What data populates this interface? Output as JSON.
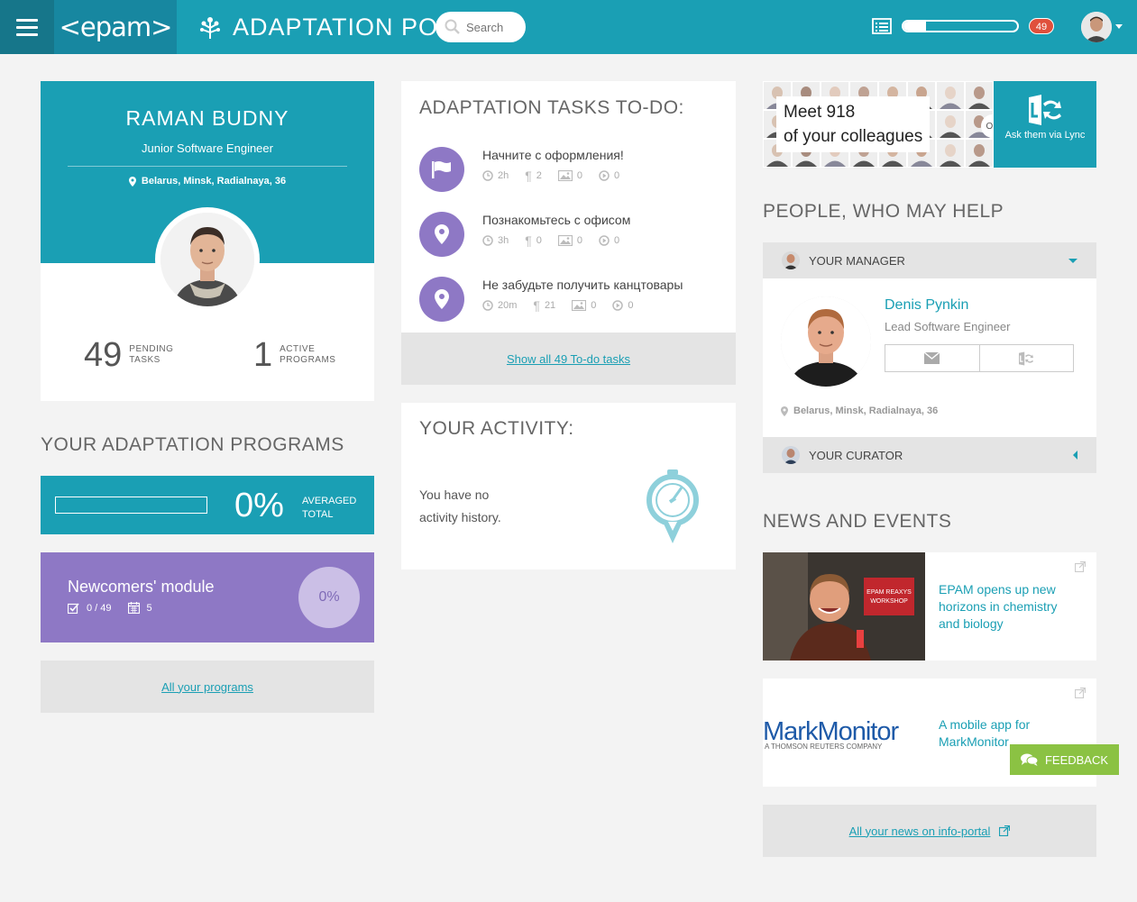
{
  "header": {
    "logo_text": "<epam>",
    "portal_title": "ADAPTATION PORTAL",
    "search_placeholder": "Search",
    "progress_fraction": 0.2,
    "notifications_count": "49"
  },
  "profile": {
    "name": "RAMAN BUDNY",
    "role": "Junior Software Engineer",
    "location": "Belarus, Minsk, Radialnaya, 36",
    "stats": [
      {
        "value": "49",
        "label_line1": "PENDING",
        "label_line2": "TASKS"
      },
      {
        "value": "1",
        "label_line1": "ACTIVE",
        "label_line2": "PROGRAMS"
      }
    ]
  },
  "programs": {
    "section_title": "YOUR ADAPTATION PROGRAMS",
    "averaged_percent": "0%",
    "averaged_fraction": 0,
    "averaged_label_line1": "AVERAGED",
    "averaged_label_line2": "TOTAL",
    "module": {
      "name": "Newcomers' module",
      "tasks_done": "0 / 49",
      "events": "5",
      "percent": "0%"
    },
    "all_link": "All your programs"
  },
  "tasks": {
    "section_title": "ADAPTATION TASKS TO-DO:",
    "items": [
      {
        "title": "Начните с оформления!",
        "time": "2h",
        "paragraphs": "2",
        "images": "0",
        "videos": "0",
        "icon": "flag-icon"
      },
      {
        "title": "Познакомьтесь с офисом",
        "time": "3h",
        "paragraphs": "0",
        "images": "0",
        "videos": "0",
        "icon": "location-pin-icon"
      },
      {
        "title": "Не забудьте получить канцтовары",
        "time": "20m",
        "paragraphs": "21",
        "images": "0",
        "videos": "0",
        "icon": "location-pin-icon"
      }
    ],
    "show_all_link": "Show all 49 To-do tasks"
  },
  "activity": {
    "section_title": "YOUR ACTIVITY:",
    "empty_text": "You have no activity history."
  },
  "meet": {
    "line1": "Meet 918",
    "line2": "of your colleagues",
    "or_text": "OR",
    "lync_label": "Ask them via Lync"
  },
  "people": {
    "section_title": "PEOPLE, WHO MAY HELP",
    "manager_header": "YOUR MANAGER",
    "manager_name": "Denis Pynkin",
    "manager_role": "Lead Software Engineer",
    "manager_location": "Belarus, Minsk, Radialnaya, 36",
    "curator_header": "YOUR CURATOR"
  },
  "news": {
    "section_title": "NEWS AND EVENTS",
    "items": [
      {
        "title": "EPAM opens up new horizons in chemistry and biology",
        "image_caption": "EPAM REAXYS WORKSHOP"
      },
      {
        "title": "A mobile app for MarkMonitor",
        "image_caption": "MarkMonitor",
        "image_subcaption": "A THOMSON REUTERS COMPANY"
      }
    ],
    "all_link": "All your news on info-portal"
  },
  "feedback_label": "FEEDBACK",
  "colors": {
    "primary": "#1a9fb4",
    "primary_dark": "#16768a",
    "purple": "#8e78c5",
    "feedback_green": "#8bc243",
    "badge_red": "#e0503c"
  }
}
